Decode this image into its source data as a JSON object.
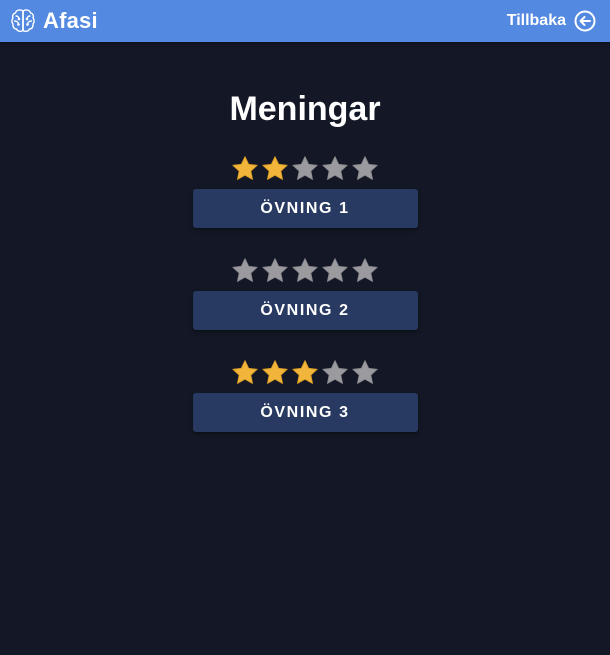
{
  "header": {
    "app_name": "Afasi",
    "logo_icon": "brain-icon",
    "back_label": "Tillbaka",
    "back_icon": "arrow-left-circle-icon",
    "bar_color": "#5389e0"
  },
  "page": {
    "title": "Meningar",
    "background_color": "#141826"
  },
  "exercises": [
    {
      "label": "ÖVNING 1",
      "stars_filled": 2,
      "stars_total": 5
    },
    {
      "label": "ÖVNING 2",
      "stars_filled": 0,
      "stars_total": 5
    },
    {
      "label": "ÖVNING 3",
      "stars_filled": 3,
      "stars_total": 5
    }
  ],
  "colors": {
    "star_filled": "#f1b53c",
    "star_empty": "#9b9b9f",
    "button_bg": "#283a62"
  }
}
